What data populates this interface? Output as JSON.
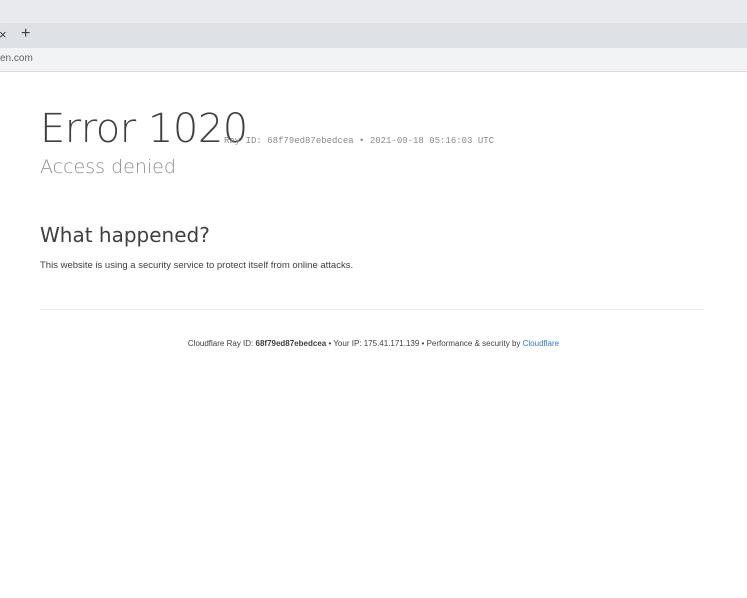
{
  "browser": {
    "tab_close_glyph": "×",
    "new_tab_glyph": "+",
    "address": "en.com"
  },
  "error": {
    "code": "Error 1020",
    "meta": "Ray ID: 68f79ed87ebedcea • 2021-09-18 05:16:03 UTC",
    "title": "Access denied"
  },
  "what_happened": {
    "heading": "What happened?",
    "text": "This website is using a security service to protect itself from online attacks."
  },
  "footer": {
    "ray_prefix": "Cloudflare Ray ID: ",
    "ray_id": "68f79ed87ebedcea",
    "sep1": " • ",
    "ip_text": "Your IP: 175.41.171.139",
    "sep2": " • ",
    "perf_text": "Performance & security by ",
    "cloudflare_link": "Cloudflare"
  },
  "colors": {
    "link": "#2f7bbf",
    "text": "#404040",
    "muted": "#8d8d8d"
  }
}
